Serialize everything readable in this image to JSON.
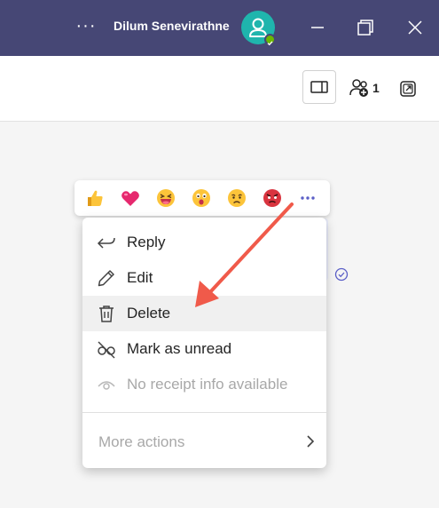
{
  "titlebar": {
    "more_label": "···",
    "user_name": "Dilum Senevirathne",
    "avatar_icon": "person-icon",
    "status": "available",
    "status_color": "#6bb700",
    "bg_color": "#464775"
  },
  "toolbar": {
    "participants_count": "1"
  },
  "reactions": [
    {
      "name": "like",
      "icon": "thumbs-up-icon"
    },
    {
      "name": "heart",
      "icon": "heart-icon"
    },
    {
      "name": "laugh",
      "icon": "laughing-face-icon"
    },
    {
      "name": "surprised",
      "icon": "surprised-face-icon"
    },
    {
      "name": "sad",
      "icon": "sad-face-icon"
    },
    {
      "name": "angry",
      "icon": "angry-face-icon"
    }
  ],
  "menu": {
    "reply": "Reply",
    "edit": "Edit",
    "delete": "Delete",
    "mark_unread": "Mark as unread",
    "receipt_info": "No receipt info available",
    "more_actions": "More actions"
  },
  "annotation": {
    "color": "#f05a4a",
    "target": "delete"
  }
}
